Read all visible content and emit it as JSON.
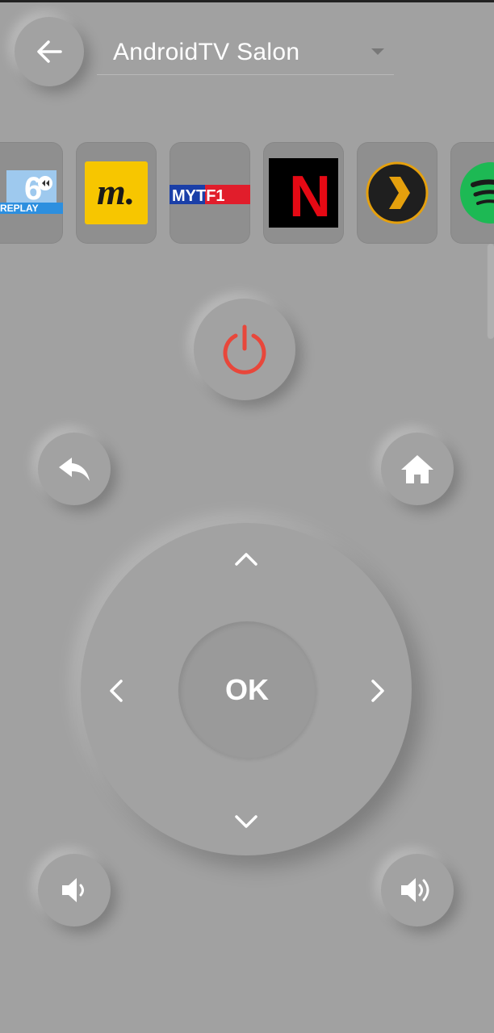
{
  "header": {
    "device_name": "AndroidTV Salon"
  },
  "apps": [
    {
      "name": "M6 Replay",
      "label": "REPLAY",
      "logo_text": "6",
      "icon": "m6-replay-logo",
      "color": "#1e78c8"
    },
    {
      "name": "Molotov",
      "logo_text": "m.",
      "icon": "molotov-logo",
      "color": "#f7c600"
    },
    {
      "name": "MyTF1",
      "logo_text": "MYTF1",
      "icon": "mytf1-logo",
      "color": "#1a3fa8"
    },
    {
      "name": "Netflix",
      "logo_text": "N",
      "icon": "netflix-logo",
      "color": "#e50914"
    },
    {
      "name": "Plex",
      "icon": "plex-logo",
      "color": "#e5a00d"
    },
    {
      "name": "Spotify",
      "icon": "spotify-logo",
      "color": "#1db954"
    }
  ],
  "remote": {
    "ok_label": "OK",
    "power_color": "#e8473b",
    "icons": [
      "power-icon",
      "return-icon",
      "home-icon",
      "chevron-up-icon",
      "chevron-left-icon",
      "chevron-right-icon",
      "chevron-down-icon",
      "volume-down-icon",
      "volume-up-icon"
    ]
  }
}
